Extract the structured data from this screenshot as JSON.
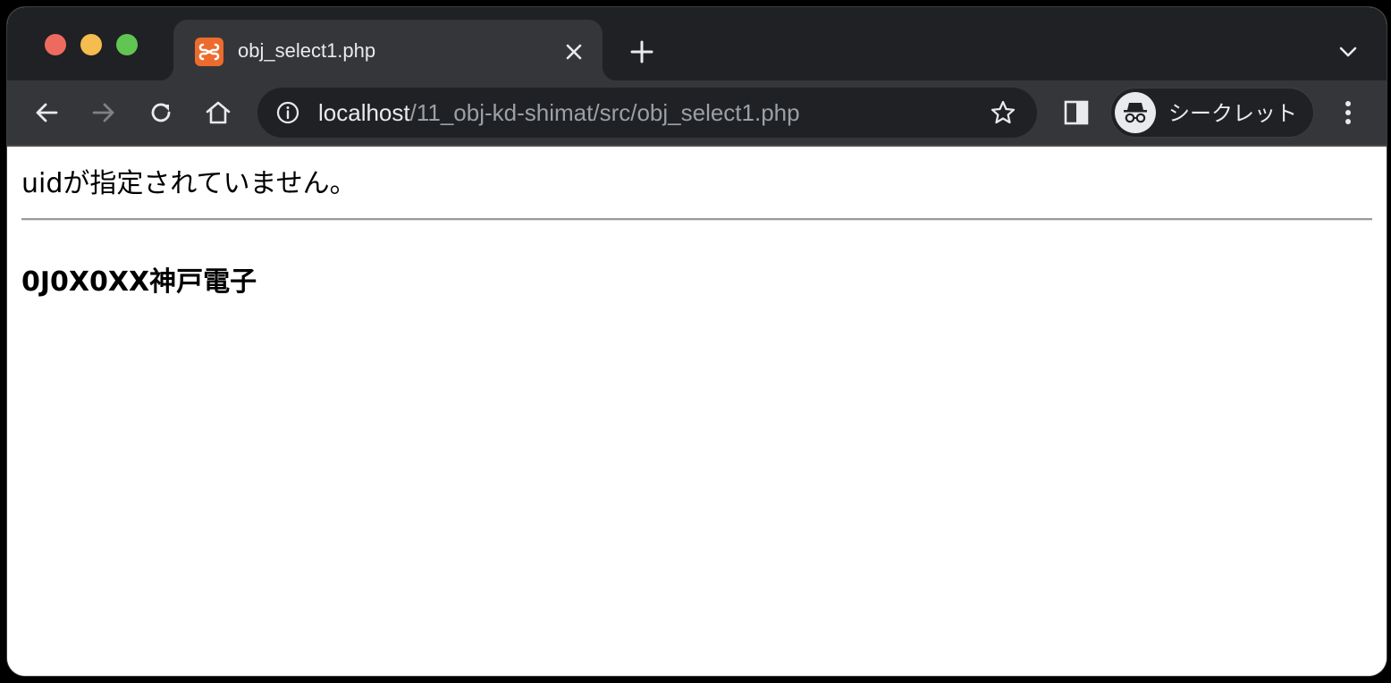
{
  "browser": {
    "tab": {
      "title": "obj_select1.php",
      "favicon": "xampp-favicon-icon"
    },
    "address_bar": {
      "host": "localhost",
      "path": "/11_obj-kd-shimat/src/obj_select1.php"
    },
    "profile": {
      "label": "シークレット",
      "icon": "incognito-icon"
    },
    "colors": {
      "tabbar": "#202124",
      "toolbar": "#35363a",
      "traffic_close": "#ee6a5f",
      "traffic_minimize": "#f5bd4f",
      "traffic_maximize": "#61c554",
      "favicon": "#ec6b2d"
    }
  },
  "page": {
    "message": "uidが指定されていません。",
    "heading": "0J0X0XX神戸電子"
  }
}
